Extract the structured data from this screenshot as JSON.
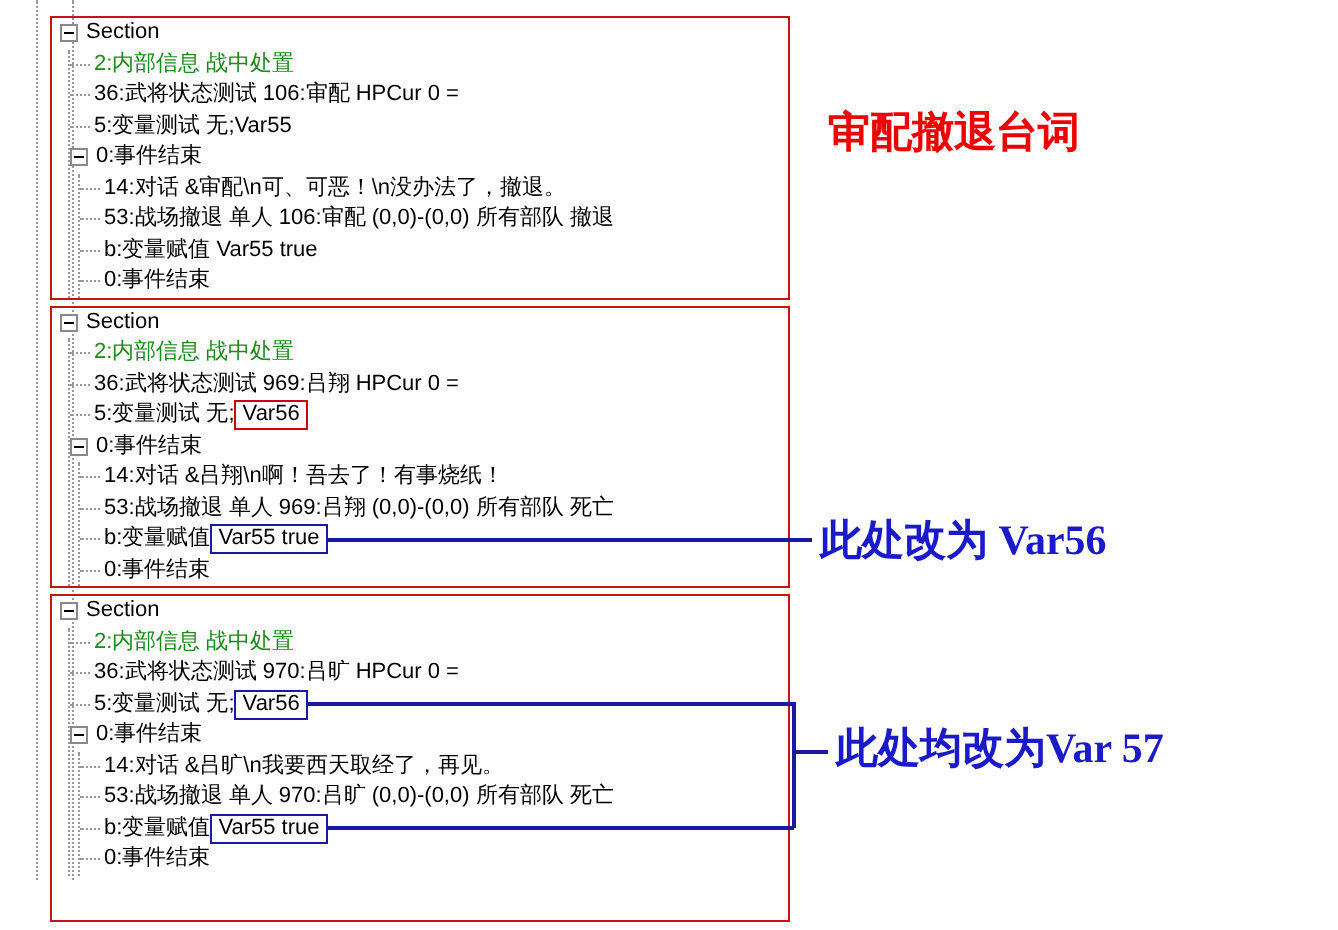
{
  "sections": [
    {
      "label": "Section",
      "expanded": true,
      "children": [
        {
          "text": "2:内部信息 战中处置",
          "kind": "comment"
        },
        {
          "text": "36:武将状态测试 106:审配 HPCur 0 =",
          "kind": "command"
        },
        {
          "text": "5:变量测试 无;Var55",
          "kind": "command"
        },
        {
          "text": "0:事件结束",
          "kind": "command",
          "expanded": true,
          "children": [
            {
              "text": "14:对话 &审配\\n可、可恶！\\n没办法了，撤退。",
              "kind": "command"
            },
            {
              "text": "53:战场撤退 单人 106:审配 (0,0)-(0,0) 所有部队 撤退",
              "kind": "command"
            },
            {
              "text": "b:变量赋值 Var55 true",
              "kind": "command"
            },
            {
              "text": "0:事件结束",
              "kind": "command"
            }
          ]
        }
      ]
    },
    {
      "label": "Section",
      "expanded": true,
      "children": [
        {
          "text": "2:内部信息 战中处置",
          "kind": "comment"
        },
        {
          "text": "36:武将状态测试 969:吕翔 HPCur 0 =",
          "kind": "command"
        },
        {
          "text": "5:变量测试 无;",
          "kind": "command",
          "tag": {
            "text": "Var56",
            "color": "#cc0000",
            "leader": false
          }
        },
        {
          "text": "0:事件结束",
          "kind": "command",
          "expanded": true,
          "children": [
            {
              "text": "14:对话 &吕翔\\n啊！吾去了！有事烧纸！",
              "kind": "command"
            },
            {
              "text": "53:战场撤退 单人 969:吕翔 (0,0)-(0,0) 所有部队 死亡",
              "kind": "command"
            },
            {
              "text": "b:变量赋值",
              "kind": "command",
              "tag": {
                "text": "Var55 true",
                "color": "#1a1aa0",
                "leader": true
              }
            },
            {
              "text": "0:事件结束",
              "kind": "command"
            }
          ]
        }
      ]
    },
    {
      "label": "Section",
      "expanded": true,
      "children": [
        {
          "text": "2:内部信息 战中处置",
          "kind": "comment"
        },
        {
          "text": "36:武将状态测试 970:吕旷 HPCur 0 =",
          "kind": "command"
        },
        {
          "text": "5:变量测试 无;",
          "kind": "command",
          "tag": {
            "text": "Var56",
            "color": "#1a1aa0",
            "leader": true
          }
        },
        {
          "text": "0:事件结束",
          "kind": "command",
          "expanded": true,
          "children": [
            {
              "text": "14:对话 &吕旷\\n我要西天取经了，再见。",
              "kind": "command"
            },
            {
              "text": "53:战场撤退 单人 970:吕旷 (0,0)-(0,0) 所有部队 死亡",
              "kind": "command"
            },
            {
              "text": "b:变量赋值",
              "kind": "command",
              "tag": {
                "text": "Var55 true",
                "color": "#1a1aa0",
                "leader": true
              }
            },
            {
              "text": "0:事件结束",
              "kind": "command"
            }
          ]
        }
      ]
    }
  ],
  "annotations": [
    {
      "text": "审配撤退台词",
      "color": "#ee0000"
    },
    {
      "text": "此处改为 Var56",
      "color": "#1a1ac8"
    },
    {
      "text": "此处均改为Var 57",
      "color": "#1a1ac8"
    }
  ]
}
